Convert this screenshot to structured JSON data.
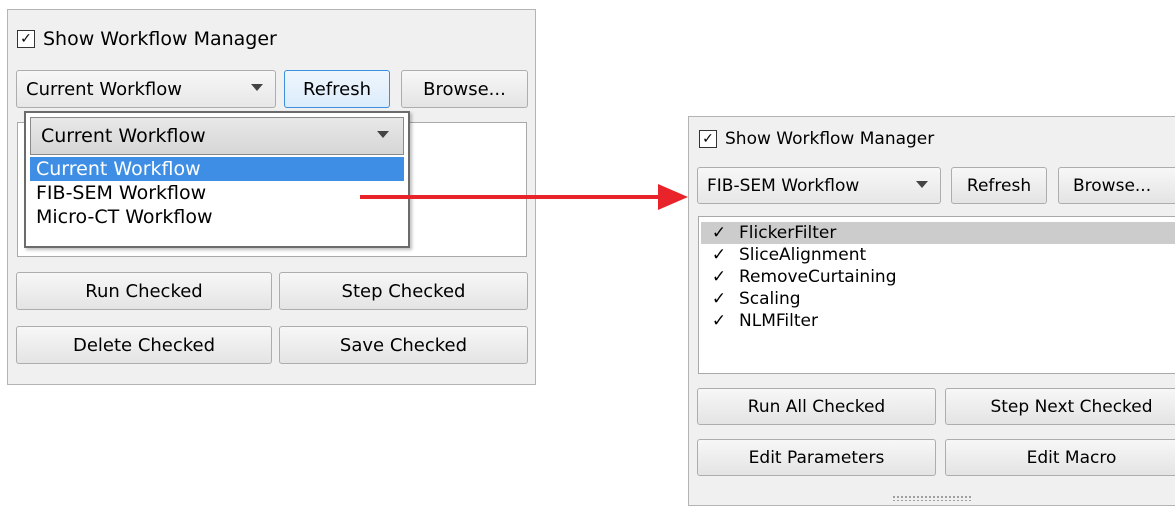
{
  "left": {
    "show_label": "Show Workflow Manager",
    "show_checked": "✓",
    "combo_value": "Current Workflow",
    "refresh_label": "Refresh",
    "browse_label": "Browse...",
    "dropdown": {
      "current": "Current Workflow",
      "options": [
        "Current Workflow",
        "FIB-SEM Workflow",
        "Micro-CT Workflow"
      ],
      "selected_index": 0
    },
    "run_label": "Run Checked",
    "step_label": "Step Checked",
    "delete_label": "Delete Checked",
    "save_label": "Save Checked"
  },
  "right": {
    "show_label": "Show Workflow Manager",
    "show_checked": "✓",
    "combo_value": "FIB-SEM Workflow",
    "refresh_label": "Refresh",
    "browse_label": "Browse...",
    "items": [
      {
        "label": "FlickerFilter",
        "check": "✓"
      },
      {
        "label": "SliceAlignment",
        "check": "✓"
      },
      {
        "label": "RemoveCurtaining",
        "check": "✓"
      },
      {
        "label": "Scaling",
        "check": "✓"
      },
      {
        "label": "NLMFilter",
        "check": "✓"
      }
    ],
    "run_label": "Run All Checked",
    "step_label": "Step Next Checked",
    "edit_params_label": "Edit Parameters",
    "edit_macro_label": "Edit Macro"
  },
  "colors": {
    "selection": "#3d8ee4",
    "arrow": "#e8232a",
    "item_highlight": "#cccccc"
  }
}
